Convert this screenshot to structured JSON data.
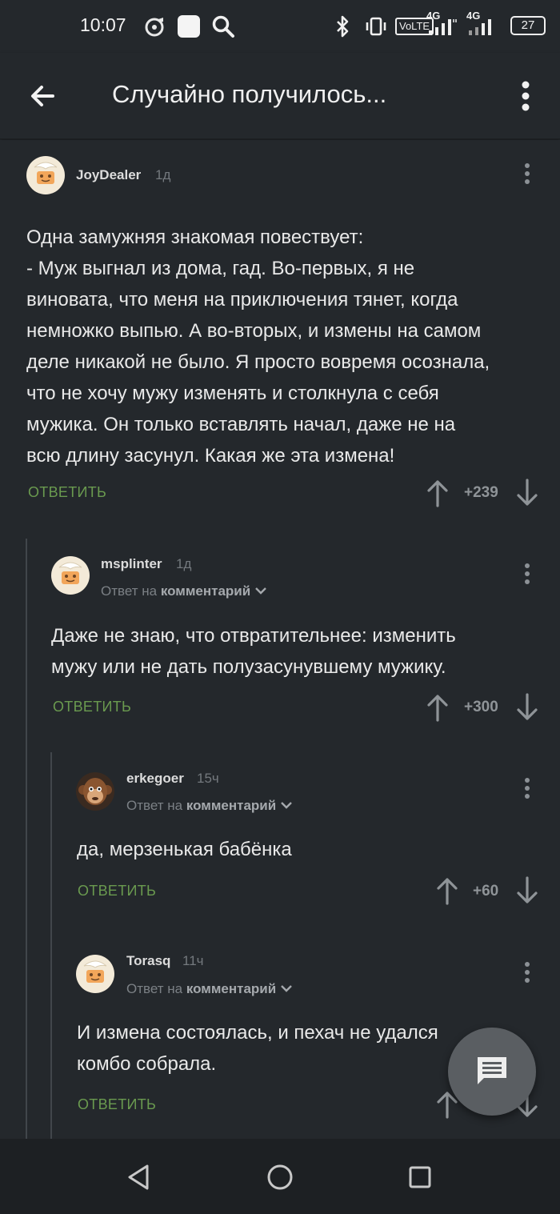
{
  "status_bar": {
    "time": "10:07",
    "battery": "27",
    "icons": [
      "music-icon",
      "square-icon",
      "search-icon",
      "bluetooth-icon",
      "vibrate-icon",
      "volte-icon",
      "signal-4g-icon",
      "signal-4g-icon",
      "battery-icon"
    ],
    "volte": "VoLTE",
    "net1": "4G",
    "net2": "4G"
  },
  "app_bar": {
    "title": "Случайно получилось...",
    "back_icon": "arrow-left-icon",
    "menu_icon": "more-vertical-icon"
  },
  "comments": [
    {
      "author": "JoyDealer",
      "time": "1д",
      "avatar": "default-avatar",
      "text_lines": [
        "Одна замужняя знакомая повествует:",
        "- Муж выгнал из дома, гад. Во-первых, я не",
        "виновата, что меня на приключения тянет, когда",
        "немножко выпью. А во-вторых, и измены на самом",
        "деле никакой не было. Я просто вовремя осознала,",
        "что не хочу мужу изменять и столкнула с себя",
        "мужика. Он только вставлять начал, даже не на",
        "всю длину засунул. Какая же эта измена!"
      ],
      "reply_label": "ОТВЕТИТЬ",
      "score": "+239"
    },
    {
      "author": "msplinter",
      "time": "1д",
      "avatar": "default-avatar",
      "reply_prefix": "Ответ на",
      "reply_target": "комментарий",
      "text_lines": [
        "Даже не знаю, что отвратительнее: изменить",
        "мужу или не дать полузасунувшему мужику."
      ],
      "reply_label": "ОТВЕТИТЬ",
      "score": "+300"
    },
    {
      "author": "erkegoer",
      "time": "15ч",
      "avatar": "monkey-avatar",
      "reply_prefix": "Ответ на",
      "reply_target": "комментарий",
      "text_lines": [
        "да, мерзенькая бабёнка"
      ],
      "reply_label": "ОТВЕТИТЬ",
      "score": "+60"
    },
    {
      "author": "Torasq",
      "time": "11ч",
      "avatar": "default-avatar",
      "reply_prefix": "Ответ на",
      "reply_target": "комментарий",
      "text_lines": [
        "И измена состоялась, и пехач не удался",
        "комбо собрала."
      ],
      "reply_label": "ОТВЕТИТЬ",
      "score": ""
    }
  ],
  "fab": {
    "icon": "comment-icon"
  },
  "nav_bar": {
    "icons": [
      "nav-back-icon",
      "nav-home-icon",
      "nav-recents-icon"
    ]
  },
  "colors": {
    "background": "#24282c",
    "reply_green": "#6a9a4f",
    "thread_line": "#41464b",
    "fab": "#5a5e62"
  }
}
